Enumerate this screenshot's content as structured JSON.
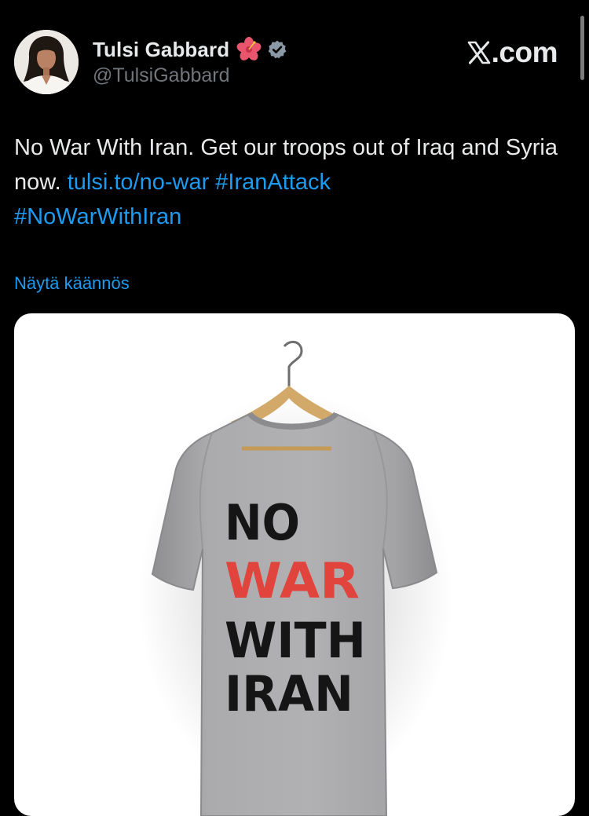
{
  "author": {
    "display_name": "Tulsi Gabbard",
    "handle": "@TulsiGabbard",
    "badge_emoji_icon": "hibiscus-flower-icon",
    "verified_icon": "verified-badge-icon",
    "avatar_icon": "profile-photo-avatar"
  },
  "site": {
    "logo_icon": "x-logo-icon",
    "label": ".com"
  },
  "tweet": {
    "text_plain": "No War With Iran. Get our troops out of Iraq and Syria now. ",
    "link": "tulsi.to/no-war",
    "hashtag1": "#IranAttack",
    "hashtag2": "#NoWarWithIran",
    "translate_label": "Näytä käännös"
  },
  "media": {
    "image_icon": "t-shirt-on-hanger-photo",
    "shirt_text": {
      "line1": "NO",
      "line2": "WAR",
      "line3": "WITH",
      "line4": "IRAN"
    }
  },
  "colors": {
    "background": "#000000",
    "text": "#e7e9ea",
    "secondary": "#71767b",
    "link": "#1d9bf0",
    "verified": "#8b98a5",
    "shirt": "#a9a9ab",
    "war_red": "#e0443c"
  }
}
